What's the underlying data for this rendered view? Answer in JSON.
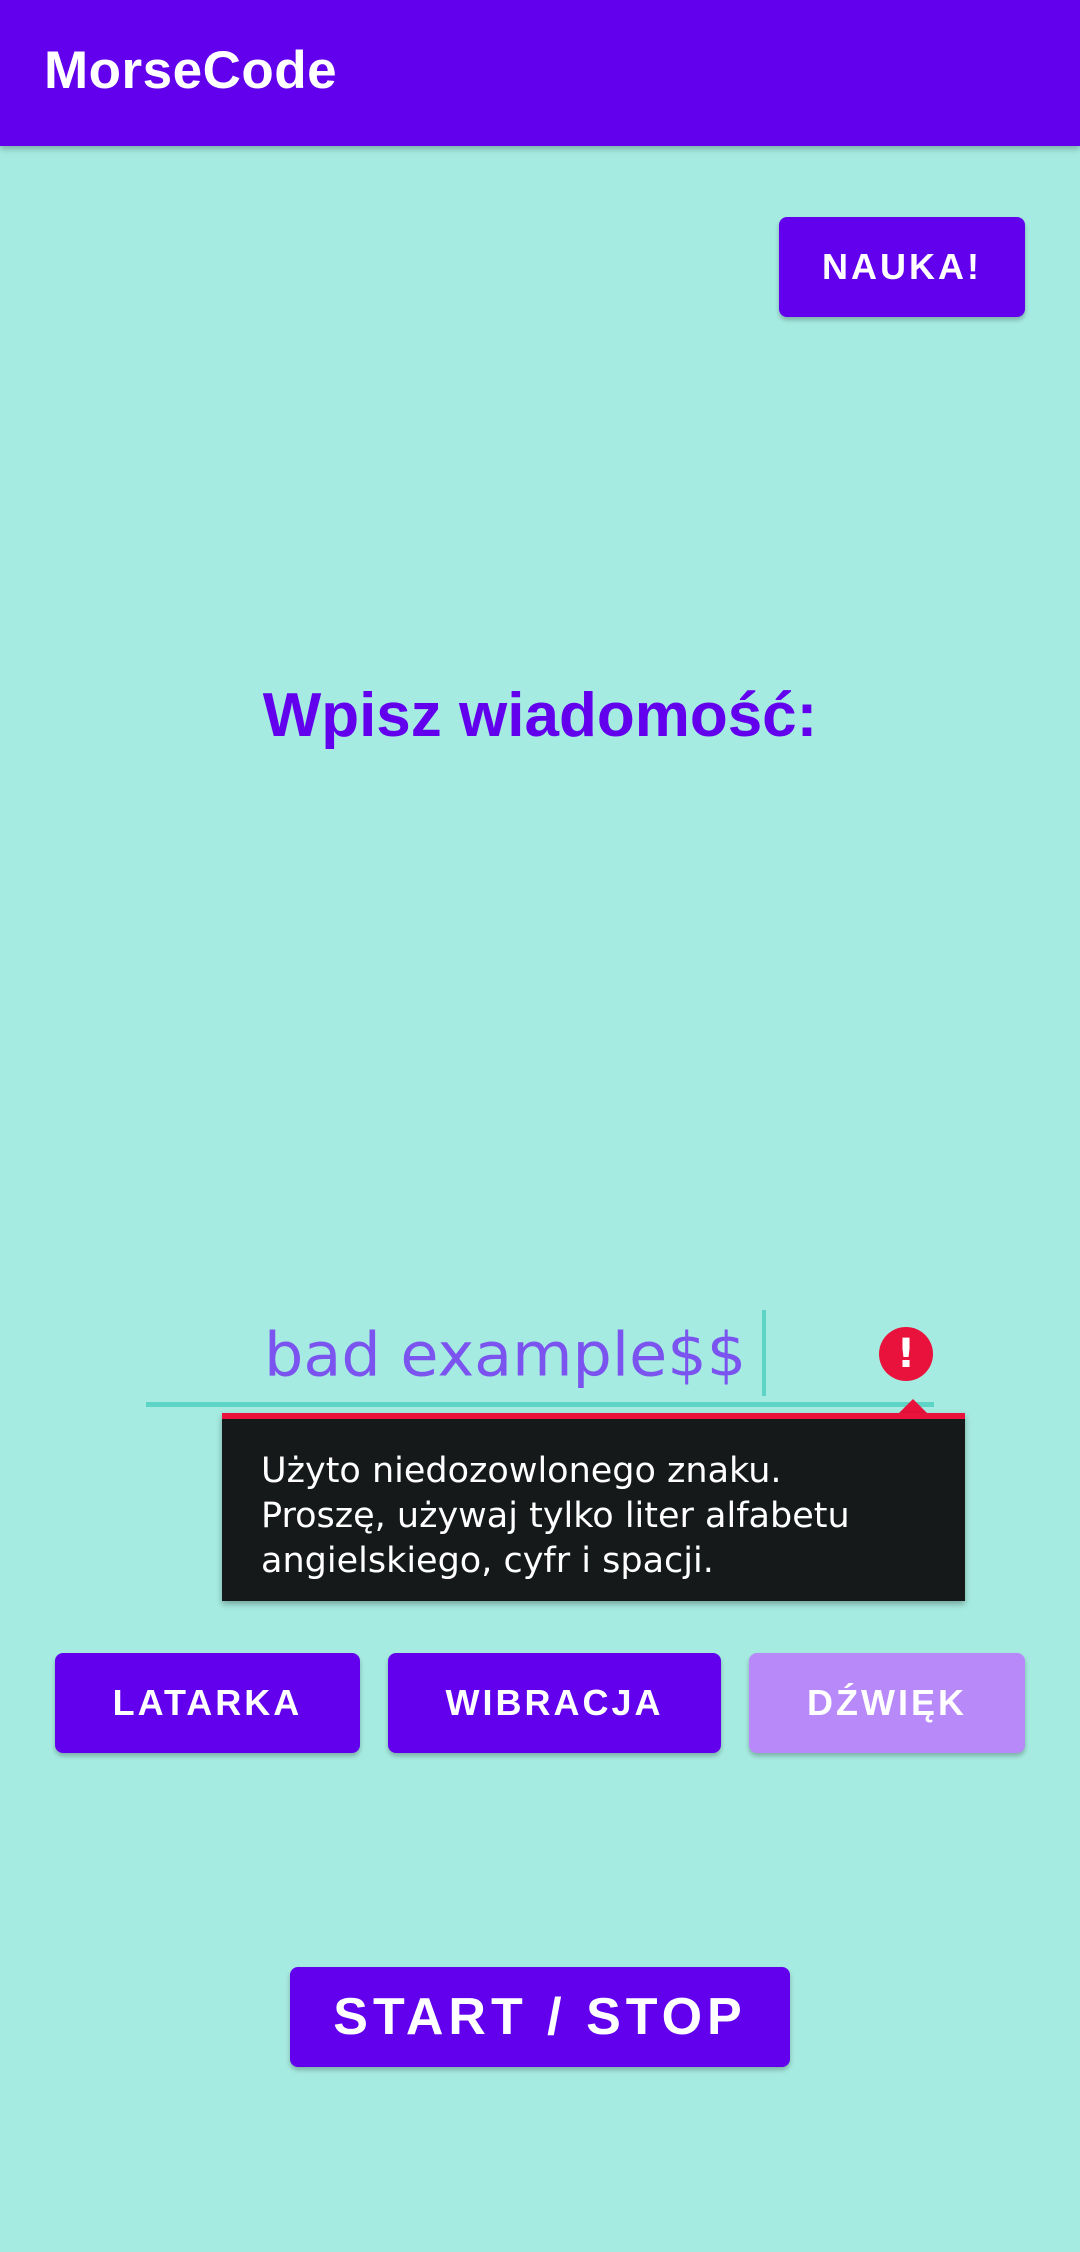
{
  "app_bar": {
    "title": "MorseCode"
  },
  "buttons": {
    "nauka": "NAUKA!",
    "latarka": "LATARKA",
    "wibracja": "WIBRACJA",
    "dzwiek": "DŹWIĘK",
    "start_stop": "START / STOP"
  },
  "heading": "Wpisz wiadomość:",
  "message_input": {
    "value": "bad example$$",
    "error_icon": "error-exclamation-icon"
  },
  "error_tooltip": {
    "line1": "Użyto niedozowlonego znaku.",
    "line2": "Proszę, używaj tylko liter alfabetu",
    "line3": "angielskiego, cyfr i spacji."
  },
  "colors": {
    "primary": "#6200EE",
    "background": "#A6EBE1",
    "disabled_button": "#B889F9",
    "error": "#E8123C",
    "tooltip_bg": "#151919"
  }
}
